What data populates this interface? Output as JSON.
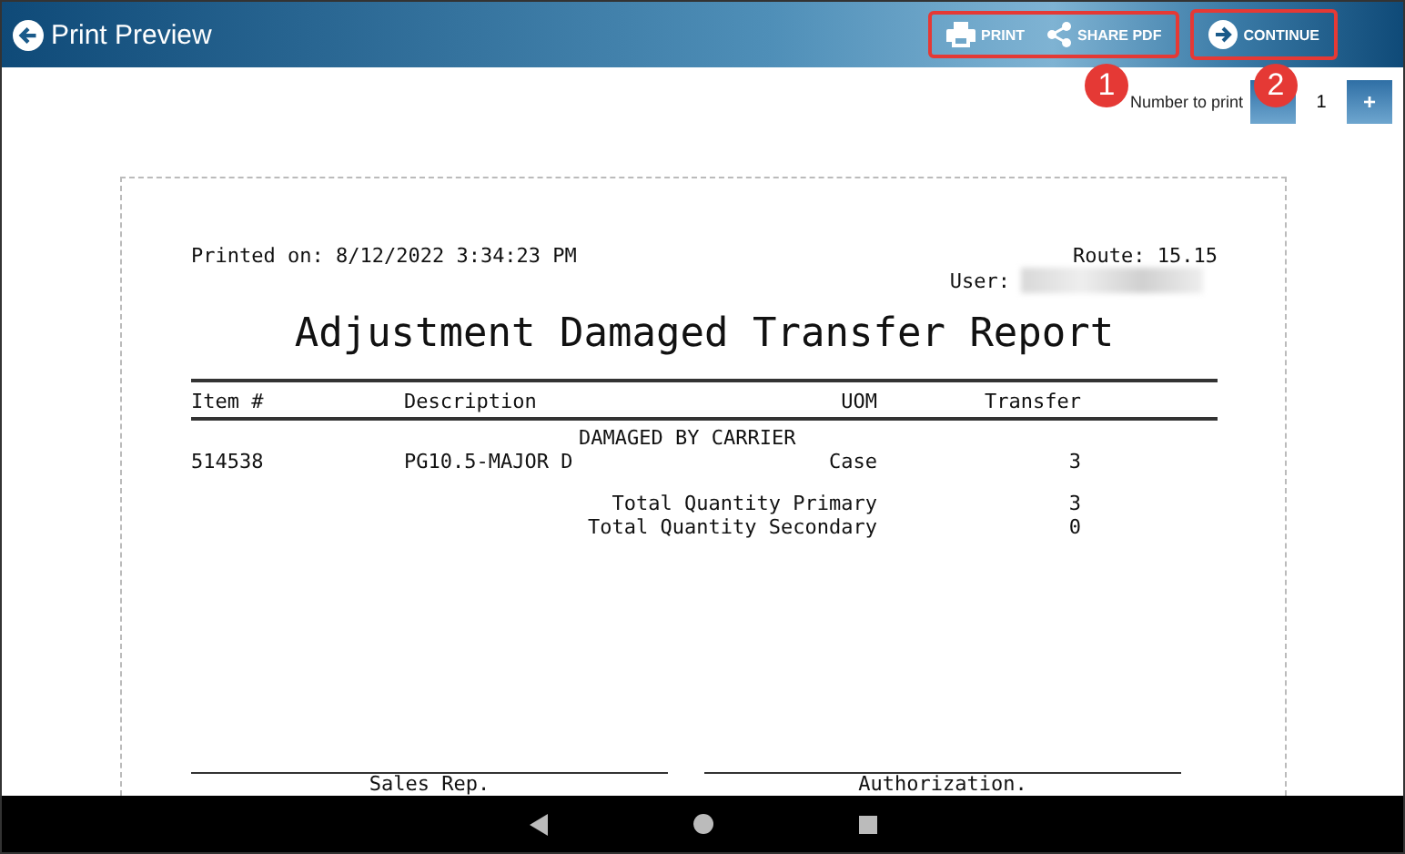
{
  "app_bar": {
    "title": "Print Preview",
    "action_groups": [
      {
        "highlighted": true,
        "callout": "1",
        "actions": [
          {
            "label": "PRINT",
            "kind": "print"
          },
          {
            "label": "SHARE PDF",
            "kind": "share"
          }
        ]
      },
      {
        "highlighted": true,
        "callout": "2",
        "actions": [
          {
            "label": "CONTINUE",
            "kind": "continue"
          }
        ]
      }
    ]
  },
  "copies": {
    "label": "Number to print",
    "value": "1",
    "increment": "+"
  },
  "report": {
    "printed_on": "Printed on: 8/12/2022 3:34:23 PM",
    "route": "Route: 15.15",
    "user_label": "User:",
    "title": "Adjustment Damaged Transfer Report",
    "columns": [
      "Item #",
      "Description",
      "UOM",
      "Transfer"
    ],
    "groups": [
      {
        "heading": "DAMAGED BY CARRIER",
        "rows": [
          {
            "item": "514538",
            "description": "PG10.5-MAJOR D",
            "uom": "Case",
            "transfer": "3"
          }
        ]
      }
    ],
    "totals": [
      {
        "label": "Total Quantity Primary",
        "value": "3"
      },
      {
        "label": "Total Quantity Secondary",
        "value": "0"
      }
    ],
    "signatures": [
      "Sales Rep.",
      "Authorization."
    ]
  }
}
